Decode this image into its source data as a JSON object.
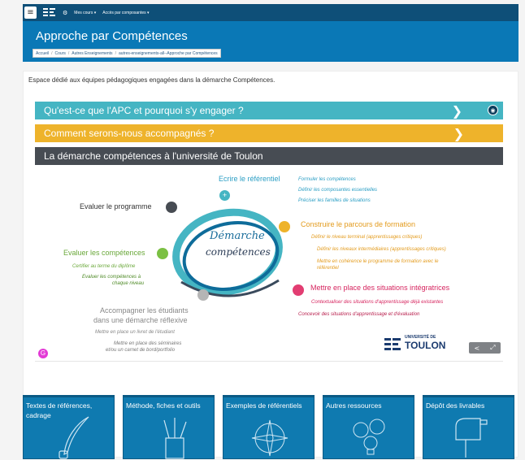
{
  "topbar": {
    "menu_items": [
      "Mes cours ▾",
      "Accès par composantes ▾"
    ]
  },
  "header": {
    "title": "Approche par Compétences",
    "breadcrumb": [
      "Accueil",
      "Cours",
      "Autres Enseignements",
      "autres-enseignements-all--Approche par Compétences"
    ]
  },
  "intro": "Espace dédié aux équipes pédagogiques engagées dans la démarche Compétences.",
  "accordions": [
    {
      "label": "Qu'est-ce que l'APC et pourquoi s'y engager ?"
    },
    {
      "label": "Comment serons-nous accompagnés ?"
    },
    {
      "label": "La démarche compétences à l'université de Toulon"
    }
  ],
  "diagram": {
    "center_line1": "Démarche",
    "center_line2": "compétences",
    "ecrire": "Ecrire le référentiel",
    "ecrire_items": [
      "Formuler les compétences",
      "Définir les composantes essentielles",
      "Préciser les familles de situations"
    ],
    "evaluer_programme": "Evaluer le programme",
    "construire": "Construire le parcours de formation",
    "construire_items": [
      "Définir le niveau terminal (apprentissages critiques)",
      "Définir les niveaux intermédiaires (apprentissages critiques)",
      "Mettre en cohérence le  programme de formation avec le",
      "référentiel"
    ],
    "evaluer_comp": "Evaluer les compétences",
    "evaluer_comp_items": [
      "Certifier au terme du diplôme",
      "Evaluer les compétences à",
      "chaque niveau"
    ],
    "situations": "Mettre en place des situations intégratrices",
    "situations_items": [
      "Contextualiser des situations d'apprentissage déjà existantes",
      "Concevoir des situations d'apprentissage et d'évaluation"
    ],
    "accompagner_1": "Accompagner les étudiants",
    "accompagner_2": "dans une démarche réflexive",
    "accompagner_items": [
      "Mettre en place un livret de l'étudiant",
      "Mettre en place des séminaires",
      "et/ou un  carnet de bord/portfolio"
    ],
    "univ_top": "UNIVERSITÉ DE",
    "univ_name": "TOULON",
    "plus": "+"
  },
  "tiles": [
    {
      "label": "Textes de références, cadrage",
      "icon": "feather-ink-icon"
    },
    {
      "label": "Méthode, fiches et outils",
      "icon": "pencils-cup-icon"
    },
    {
      "label": "Exemples de référentiels",
      "icon": "compass-rose-icon"
    },
    {
      "label": "Autres ressources",
      "icon": "lightbulbs-icon"
    },
    {
      "label": "Dépôt des livrables",
      "icon": "mailbox-icon"
    }
  ],
  "colors": {
    "teal": "#45b5c3",
    "yellow": "#eeb32b",
    "dark": "#474c53",
    "navy": "#0e4f78",
    "blue": "#0a78b6",
    "green": "#7bc043",
    "pink": "#e23d72"
  }
}
